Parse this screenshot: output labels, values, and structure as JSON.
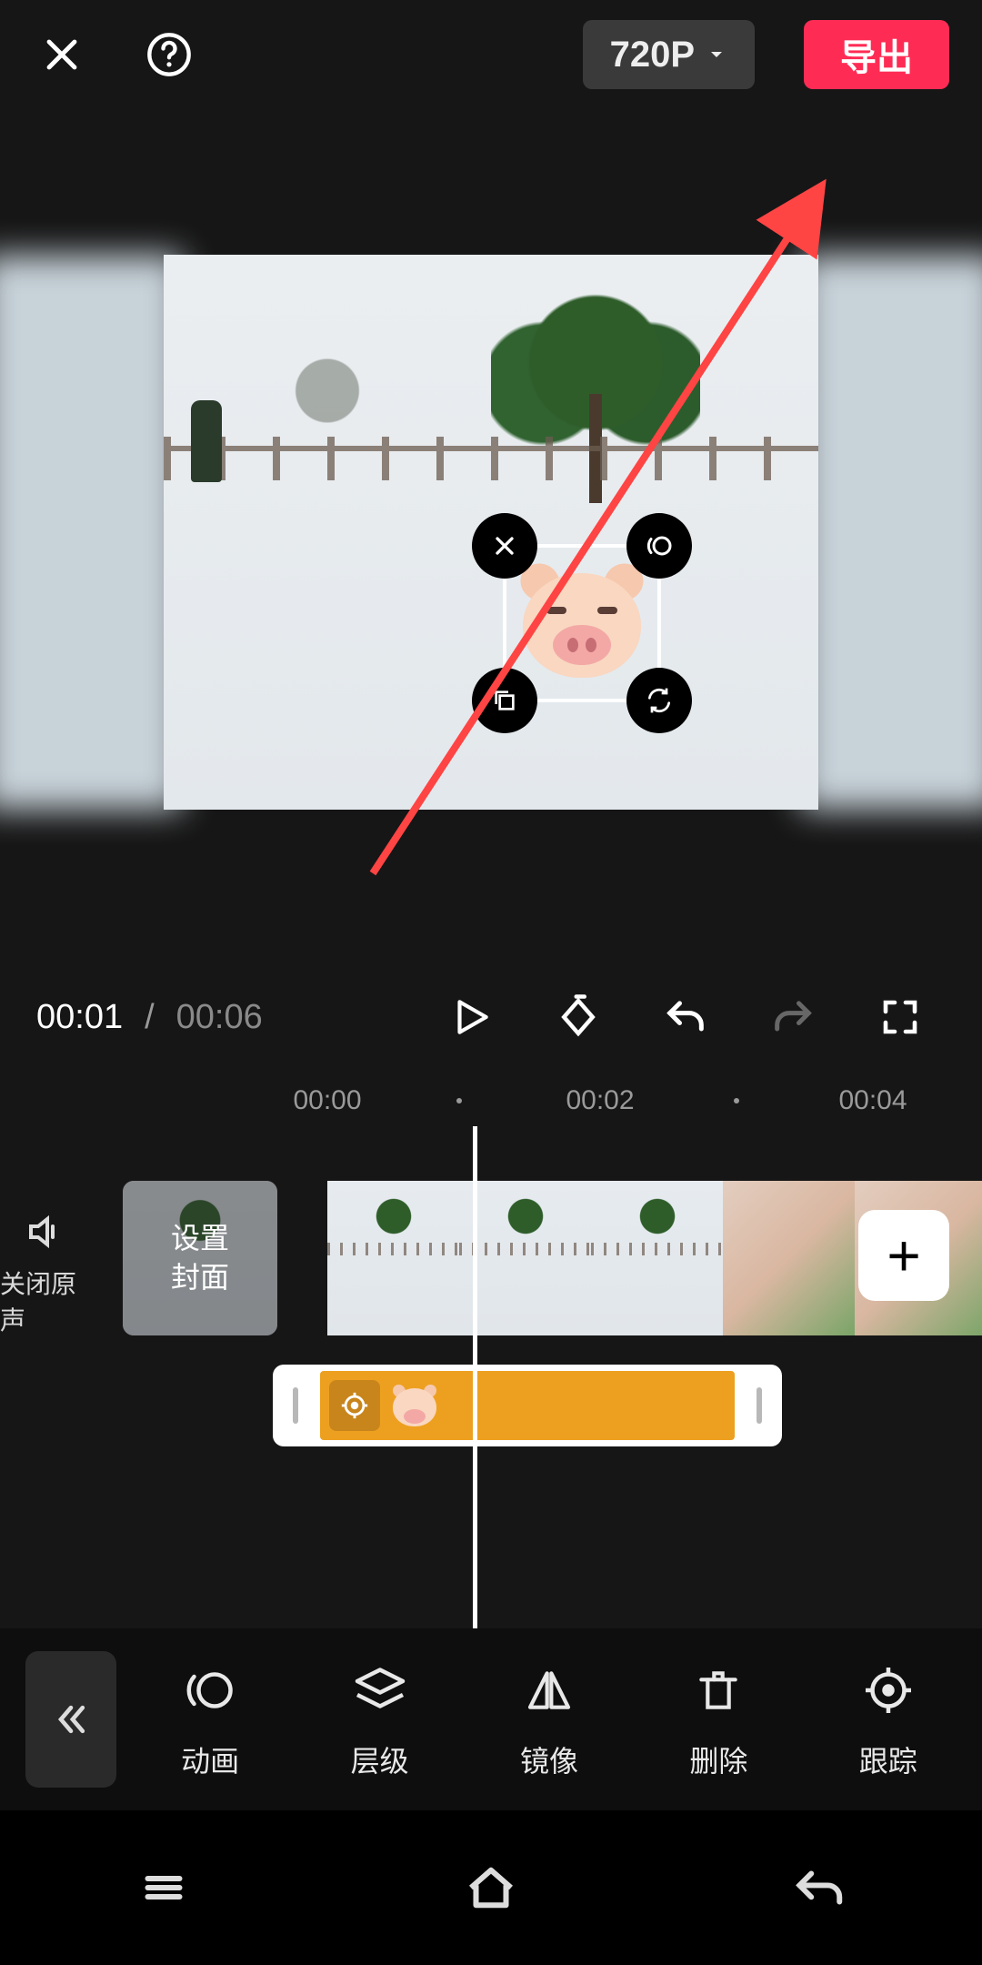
{
  "header": {
    "resolution_label": "720P",
    "export_label": "导出"
  },
  "sticker_handles": {
    "tl": "close-icon",
    "tr": "motion-icon",
    "bl": "copy-icon",
    "br": "rotate-icon"
  },
  "transport": {
    "current_time": "00:01",
    "total_time": "00:06"
  },
  "ruler": {
    "m1": "00:00",
    "m2": "00:02",
    "m3": "00:04"
  },
  "timeline": {
    "mute_label": "关闭原声",
    "cover_line1": "设置",
    "cover_line2": "封面",
    "add_label": "+"
  },
  "toolbar": {
    "collapse": "«",
    "items": [
      {
        "label": "动画"
      },
      {
        "label": "层级"
      },
      {
        "label": "镜像"
      },
      {
        "label": "删除"
      },
      {
        "label": "跟踪"
      }
    ]
  }
}
